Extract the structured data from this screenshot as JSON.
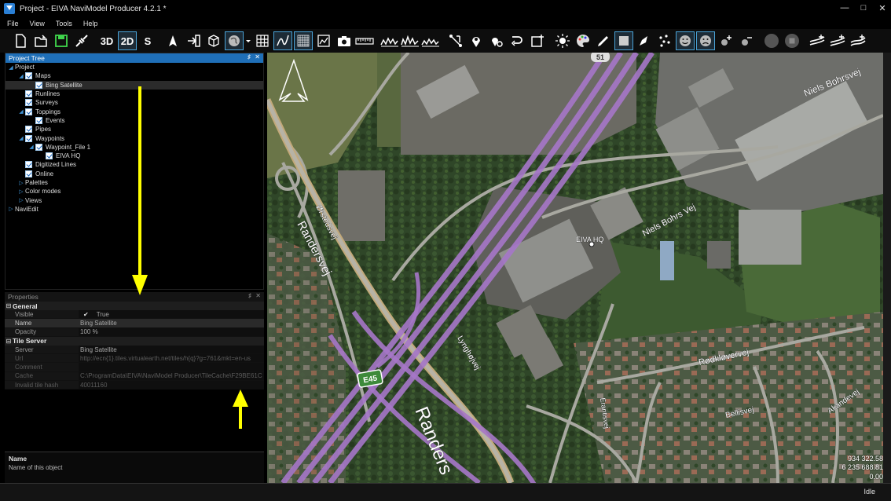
{
  "window": {
    "title": "Project - EIVA NaviModel Producer 4.2.1 *"
  },
  "menu": [
    "File",
    "View",
    "Tools",
    "Help"
  ],
  "toolbar": {
    "btn3d": "3D",
    "btn2d": "2D",
    "btnS": "S"
  },
  "project_tree": {
    "header": "Project Tree",
    "rows": [
      {
        "label": "Project",
        "indent": 0,
        "arrow": "◢",
        "cb": ""
      },
      {
        "label": "Maps",
        "indent": 1,
        "arrow": "◢",
        "cb": "checked"
      },
      {
        "label": "Bing Satellite",
        "indent": 2,
        "arrow": "",
        "cb": "checked",
        "selected": true
      },
      {
        "label": "Runlines",
        "indent": 1,
        "arrow": "",
        "cb": "checked"
      },
      {
        "label": "Surveys",
        "indent": 1,
        "arrow": "",
        "cb": "checked"
      },
      {
        "label": "Toppings",
        "indent": 1,
        "arrow": "◢",
        "cb": "checked"
      },
      {
        "label": "Events",
        "indent": 2,
        "arrow": "",
        "cb": "checked"
      },
      {
        "label": "Pipes",
        "indent": 1,
        "arrow": "",
        "cb": "checked"
      },
      {
        "label": "Waypoints",
        "indent": 1,
        "arrow": "◢",
        "cb": "checked"
      },
      {
        "label": "Waypoint_File 1",
        "indent": 2,
        "arrow": "◢",
        "cb": "checked"
      },
      {
        "label": "EIVA HQ",
        "indent": 3,
        "arrow": "",
        "cb": "checked"
      },
      {
        "label": "Digitized Lines",
        "indent": 1,
        "arrow": "",
        "cb": "checked"
      },
      {
        "label": "Online",
        "indent": 1,
        "arrow": "",
        "cb": "checked"
      },
      {
        "label": "Palettes",
        "indent": 1,
        "arrow": "▷",
        "cb": ""
      },
      {
        "label": "Color modes",
        "indent": 1,
        "arrow": "▷",
        "cb": ""
      },
      {
        "label": "Views",
        "indent": 1,
        "arrow": "▷",
        "cb": ""
      },
      {
        "label": "NaviEdit",
        "indent": 0,
        "arrow": "▷",
        "cb": ""
      }
    ]
  },
  "properties": {
    "header": "Properties",
    "sections": [
      {
        "title": "General",
        "rows": [
          {
            "k": "Visible",
            "v": "True",
            "check": true
          },
          {
            "k": "Name",
            "v": "Bing Satellite",
            "selected": true
          },
          {
            "k": "Opacity",
            "v": "100 %"
          }
        ]
      },
      {
        "title": "Tile Server",
        "rows": [
          {
            "k": "Server",
            "v": "Bing Satellite"
          },
          {
            "k": "Url",
            "v": "http://ecn{1}.tiles.virtualearth.net/tiles/h{q}?g=761&mkt=en-us",
            "dim": true
          },
          {
            "k": "Comment",
            "v": "",
            "dim": true
          },
          {
            "k": "Cache",
            "v": "C:\\ProgramData\\EIVA\\NaviModel Producer\\TileCache\\F29BE61C",
            "dim": true
          },
          {
            "k": "Invalid tile hash",
            "v": "40011160",
            "dim": true
          }
        ]
      }
    ],
    "desc_name": "Name",
    "desc_text": "Name of this object"
  },
  "map": {
    "labels": {
      "eiva_hq": "EIVA HQ",
      "niels1": "Niels Bohrsvej",
      "niels2": "Niels Bohrs Vej",
      "randers1": "Randersvej",
      "randers2": "Randers",
      "orsted": "Ørstedsvej",
      "lyngho": "Lynghøjvej",
      "rodklover": "Rødkløvervej",
      "bellis": "Bellisvej",
      "akande": "Akandevej",
      "erantis": "Erantisvej",
      "e45": "E45",
      "r51": "51"
    },
    "coord1": "934 322.58",
    "coord2": "6 235 688.81",
    "coord3": "0.00"
  },
  "status": "Idle",
  "colors": {
    "accent": "#1f6fb8",
    "road": "#a677c8",
    "annotation_arrow": "#ffff00"
  }
}
